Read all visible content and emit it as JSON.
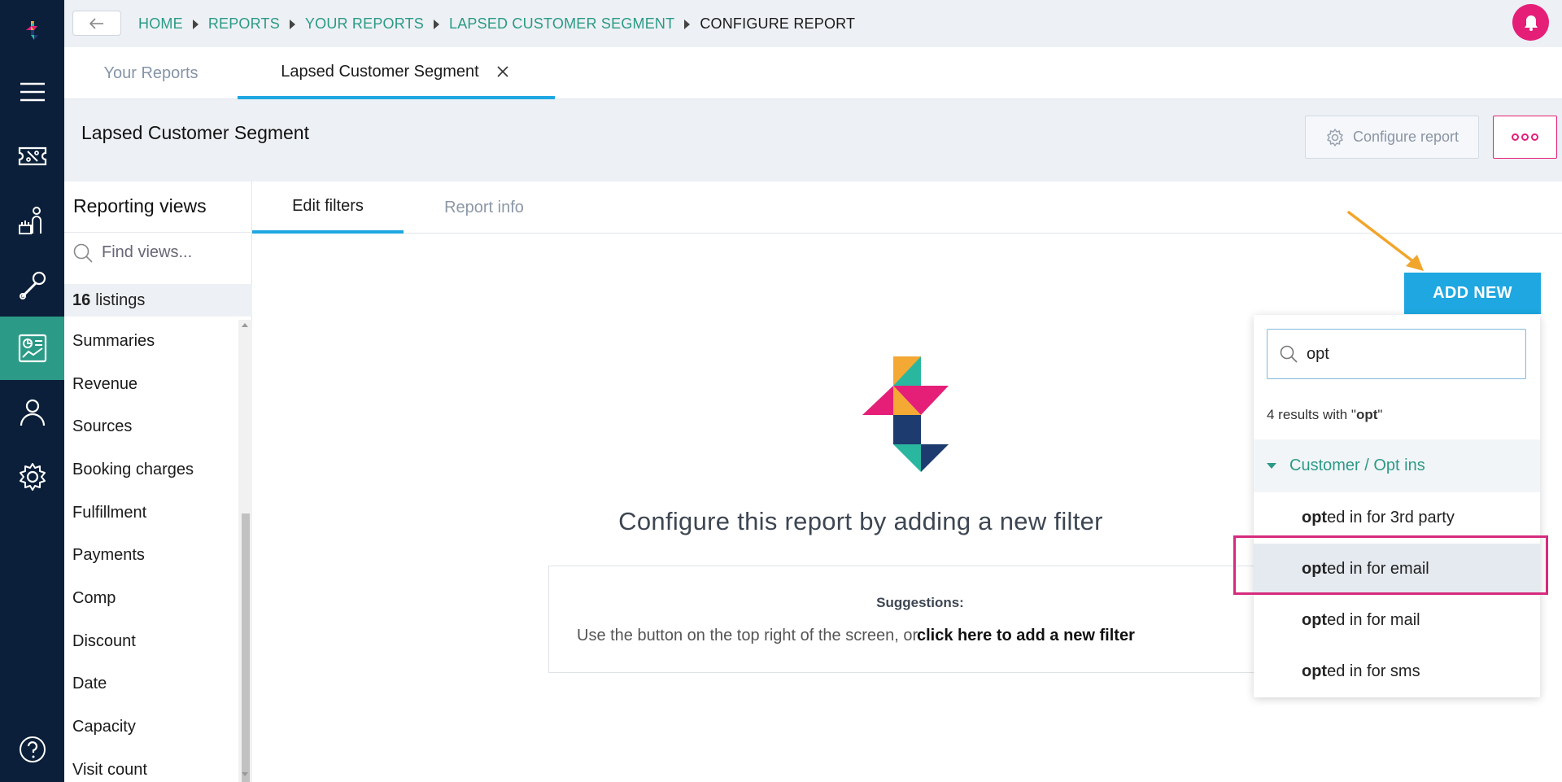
{
  "rail": {
    "items": [
      {
        "icon": "logo-icon"
      },
      {
        "icon": "menu-icon"
      },
      {
        "icon": "ticket-icon"
      },
      {
        "icon": "customer-service-icon"
      },
      {
        "icon": "tools-icon"
      },
      {
        "icon": "reports-icon",
        "active": true
      },
      {
        "icon": "user-icon"
      },
      {
        "icon": "settings-icon"
      },
      {
        "icon": "help-icon"
      }
    ]
  },
  "topbar": {
    "breadcrumb": [
      "HOME",
      "REPORTS",
      "YOUR REPORTS",
      "LAPSED CUSTOMER SEGMENT",
      "CONFIGURE REPORT"
    ]
  },
  "tabs": {
    "your_reports": "Your Reports",
    "active": "Lapsed Customer Segment"
  },
  "report": {
    "title": "Lapsed Customer Segment",
    "configure_label": "Configure report"
  },
  "views": {
    "title": "Reporting views",
    "search_placeholder": "Find views...",
    "listings_count": "16",
    "listings_label": "listings",
    "items": [
      "Summaries",
      "Revenue",
      "Sources",
      "Booking charges",
      "Fulfillment",
      "Payments",
      "Comp",
      "Discount",
      "Date",
      "Capacity",
      "Visit count"
    ]
  },
  "main": {
    "tab_edit": "Edit filters",
    "tab_info": "Report info",
    "add_new": "ADD NEW",
    "empty_message": "Configure this report by adding a new filter",
    "suggestions_title": "Suggestions:",
    "suggestions_text": "Use the button on the top right of the screen, or",
    "suggestions_link": "click here to add a new filter"
  },
  "dropdown": {
    "search_value": "opt",
    "count_text": "4 results with \"",
    "count_term": "opt",
    "count_suffix": "\"",
    "group": "Customer / Opt ins",
    "match": "opt",
    "options": [
      {
        "match": "opt",
        "rest": "ed in for 3rd party"
      },
      {
        "match": "opt",
        "rest": "ed in for email"
      },
      {
        "match": "opt",
        "rest": "ed in for mail"
      },
      {
        "match": "opt",
        "rest": "ed in for sms"
      }
    ],
    "highlighted_index": 1
  },
  "colors": {
    "rail": "#0b1f3a",
    "teal": "#2b9a86",
    "blue": "#1ea7e1",
    "pink": "#e51f78"
  }
}
